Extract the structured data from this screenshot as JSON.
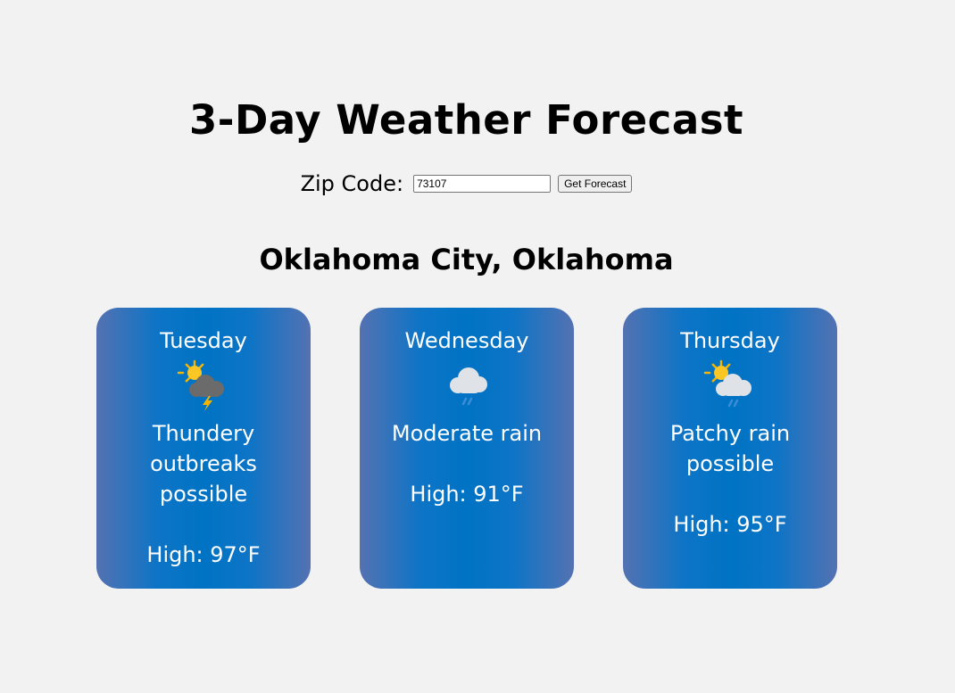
{
  "header": {
    "title": "3-Day Weather Forecast"
  },
  "zip": {
    "label": "Zip Code:",
    "value": "73107",
    "button_label": "Get Forecast"
  },
  "location": {
    "city": "Oklahoma City, Oklahoma"
  },
  "forecast": [
    {
      "day": "Tuesday",
      "icon": "thunderstorm-sun-icon",
      "description": "Thundery outbreaks possible",
      "high": "High: 97°F"
    },
    {
      "day": "Wednesday",
      "icon": "rain-cloud-icon",
      "description": "Moderate rain",
      "high": "High: 91°F"
    },
    {
      "day": "Thursday",
      "icon": "sun-rain-cloud-icon",
      "description": "Patchy rain possible",
      "high": "High: 95°F"
    }
  ],
  "colors": {
    "page_background": "#f2f2f2",
    "card_center": "#0073c4",
    "card_edge": "#5472b2",
    "card_text": "#ffffff"
  }
}
